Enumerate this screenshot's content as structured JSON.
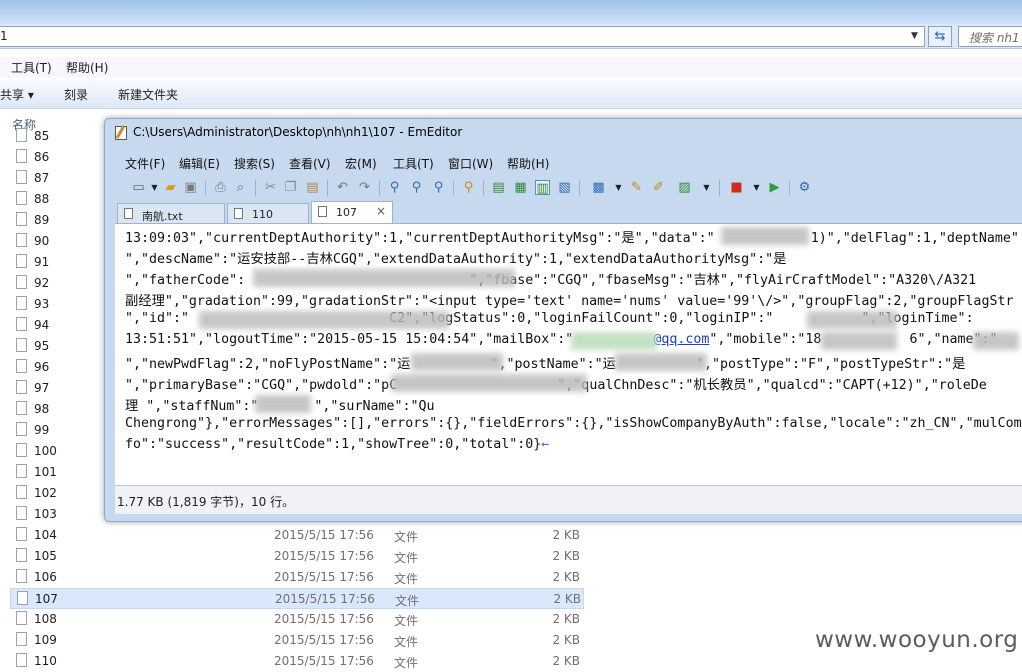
{
  "explorer": {
    "address_text": "1",
    "search_placeholder": "搜索 nh1",
    "menu": [
      "工具(T)",
      "帮助(H)"
    ],
    "commands": [
      "共享 ▾",
      "刻录",
      "新建文件夹"
    ],
    "column_name": "名称",
    "files": [
      {
        "name": "85"
      },
      {
        "name": "86"
      },
      {
        "name": "87"
      },
      {
        "name": "88"
      },
      {
        "name": "89"
      },
      {
        "name": "90"
      },
      {
        "name": "91"
      },
      {
        "name": "92"
      },
      {
        "name": "93"
      },
      {
        "name": "94"
      },
      {
        "name": "95"
      },
      {
        "name": "96"
      },
      {
        "name": "97"
      },
      {
        "name": "98"
      },
      {
        "name": "99"
      },
      {
        "name": "100"
      },
      {
        "name": "101"
      },
      {
        "name": "102"
      },
      {
        "name": "103"
      },
      {
        "name": "104",
        "date": "2015/5/15 17:56",
        "type": "文件",
        "size": "2 KB"
      },
      {
        "name": "105",
        "date": "2015/5/15 17:56",
        "type": "文件",
        "size": "2 KB"
      },
      {
        "name": "106",
        "date": "2015/5/15 17:56",
        "type": "文件",
        "size": "2 KB"
      },
      {
        "name": "107",
        "date": "2015/5/15 17:56",
        "type": "文件",
        "size": "2 KB",
        "selected": true
      },
      {
        "name": "108",
        "date": "2015/5/15 17:56",
        "type": "文件",
        "size": "2 KB"
      },
      {
        "name": "109",
        "date": "2015/5/15 17:56",
        "type": "文件",
        "size": "2 KB"
      },
      {
        "name": "110",
        "date": "2015/5/15 17:56",
        "type": "文件",
        "size": "2 KB"
      }
    ]
  },
  "editor": {
    "title": "C:\\Users\\Administrator\\Desktop\\nh\\nh1\\107 - EmEditor",
    "menu": [
      "文件(F)",
      "编辑(E)",
      "搜索(S)",
      "查看(V)",
      "宏(M)",
      "工具(T)",
      "窗口(W)",
      "帮助(H)"
    ],
    "tabs": [
      {
        "label": "南航.txt"
      },
      {
        "label": "110"
      },
      {
        "label": "107",
        "active": true,
        "close": "×"
      }
    ],
    "lines": [
      "13:09:03\",\"currentDeptAuthority\":1,\"currentDeptAuthorityMsg\":\"是\",\"data\":\"            1)\",\"delFlag\":1,\"deptName\"",
      "\",\"descName\":\"运安技部--吉林CGQ\",\"extendDataAuthority\":1,\"extendDataAuthorityMsg\":\"是",
      "\",\"fatherCode\":                            \",\"fbase\":\"CGQ\",\"fbaseMsg\":\"吉林\",\"flyAirCraftModel\":\"A320\\/A321",
      "副经理\",\"gradation\":99,\"gradationStr\":\"<input type='text' name='nums' value='99'\\/>\",\"groupFlag\":2,\"groupFlagStr",
      "\",\"id\":\"                         C2\",\"logStatus\":0,\"loginFailCount\":0,\"loginIP\":\"           \",\"loginTime\":",
      "13:51:51\",\"logoutTime\":\"2015-05-15 15:04:54\",\"mailBox\":\"",
      "\",\"newPwdFlag\":2,\"noFlyPostName\":\"运          \",\"postName\":\"运          \",\"postType\":\"F\",\"postTypeStr\":\"是",
      "\",\"primaryBase\":\"CGQ\",\"pwdold\":\"pC                    \",\"qualChnDesc\":\"机长教员\",\"qualcd\":\"CAPT(+12)\",\"roleDe",
      "理 \",\"staffNum\":\"       \",\"surName\":\"Qu",
      "Chengrong\"},\"errorMessages\":[],\"errors\":{},\"fieldErrors\":{},\"isShowCompanyByAuth\":false,\"locale\":\"zh_CN\",\"mulCom",
      "fo\":\"success\",\"resultCode\":1,\"showTree\":0,\"total\":0}"
    ],
    "line6_link": "@qq.com",
    "line6_tail": "\",\"mobile\":\"18           6\",\"name\":\"",
    "eol_mark": "←",
    "status": "1.77 KB (1,819 字节)，10 行。"
  },
  "watermark": "www.wooyun.org"
}
